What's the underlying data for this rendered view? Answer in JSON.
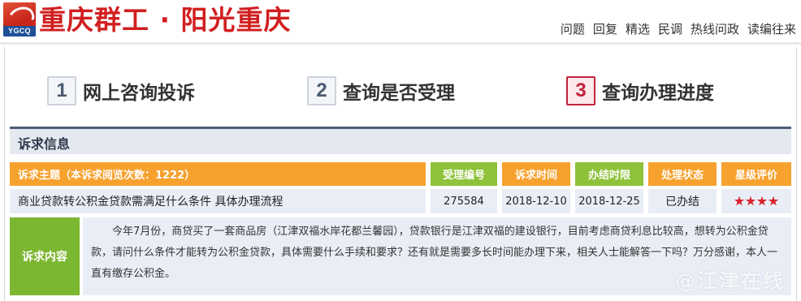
{
  "brand": {
    "logo_text": "YGCQ",
    "title": "重庆群工 · 阳光重庆"
  },
  "topnav": [
    "问题",
    "回复",
    "精选",
    "民调",
    "热线问政",
    "读编往来"
  ],
  "steps": [
    {
      "num": "1",
      "label": "网上咨询投诉",
      "active": false
    },
    {
      "num": "2",
      "label": "查询是否受理",
      "active": false
    },
    {
      "num": "3",
      "label": "查询办理进度",
      "active": true
    }
  ],
  "section": {
    "title": "诉求信息"
  },
  "table": {
    "headers": {
      "topic": "诉求主题（本诉求阅览次数：1222）",
      "id": "受理编号",
      "time": "诉求时间",
      "deadline": "办结时限",
      "status": "处理状态",
      "rating": "星级评价"
    },
    "row": {
      "topic": "商业贷款转公积金贷款需满足什么条件 具体办理流程",
      "id": "275584",
      "time": "2018-12-10",
      "deadline": "2018-12-25",
      "status": "已办结",
      "rating": 4
    }
  },
  "content": {
    "label": "诉求内容",
    "text": "今年7月份，商贷买了一套商品房（江津双福水岸花都兰馨园），贷款银行是江津双福的建设银行，目前考虑商贷利息比较高，想转为公积金贷款，请问什么条件才能转为公积金贷款，具体需要什么手续和要求？还有就是需要多长时间能办理下来，相关人士能解答一下吗？万分感谢，本人一直有缴存公积金。"
  },
  "watermark": "@江津在线",
  "colors": {
    "brand_red": "#d11f20",
    "orange": "#f7a12e",
    "green": "#8dc23a",
    "content_green": "#7cb731",
    "section_bar": "#4d5d78",
    "row_bg": "#e9eef6",
    "star": "#d9232b"
  }
}
